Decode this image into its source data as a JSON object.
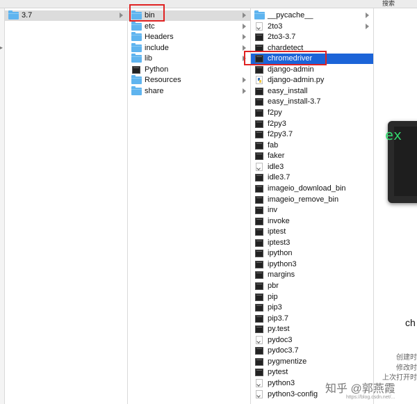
{
  "toolbar": {
    "search_label": "搜索"
  },
  "column1": {
    "items": [
      {
        "label": "3.7",
        "icon": "folder-icon",
        "has_arrow": true,
        "selected": true
      }
    ]
  },
  "column2": {
    "items": [
      {
        "label": "bin",
        "icon": "folder-icon",
        "has_arrow": true,
        "selected": true
      },
      {
        "label": "etc",
        "icon": "folder-icon",
        "has_arrow": true
      },
      {
        "label": "Headers",
        "icon": "folder-alias-icon",
        "has_arrow": true
      },
      {
        "label": "include",
        "icon": "folder-icon",
        "has_arrow": true
      },
      {
        "label": "lib",
        "icon": "folder-icon",
        "has_arrow": true
      },
      {
        "label": "Python",
        "icon": "executable-icon",
        "has_arrow": false
      },
      {
        "label": "Resources",
        "icon": "folder-icon",
        "has_arrow": true
      },
      {
        "label": "share",
        "icon": "folder-icon",
        "has_arrow": true
      }
    ]
  },
  "column3": {
    "items": [
      {
        "label": "__pycache__",
        "icon": "folder-icon",
        "has_arrow": true
      },
      {
        "label": "2to3",
        "icon": "alias-document-icon",
        "has_arrow": true
      },
      {
        "label": "2to3-3.7",
        "icon": "executable-icon",
        "has_arrow": false
      },
      {
        "label": "chardetect",
        "icon": "executable-icon",
        "has_arrow": false
      },
      {
        "label": "chromedriver",
        "icon": "executable-icon",
        "has_arrow": false,
        "selected": true
      },
      {
        "label": "django-admin",
        "icon": "executable-icon",
        "has_arrow": false
      },
      {
        "label": "django-admin.py",
        "icon": "python-file-icon",
        "has_arrow": false
      },
      {
        "label": "easy_install",
        "icon": "executable-icon",
        "has_arrow": false
      },
      {
        "label": "easy_install-3.7",
        "icon": "executable-icon",
        "has_arrow": false
      },
      {
        "label": "f2py",
        "icon": "executable-icon",
        "has_arrow": false
      },
      {
        "label": "f2py3",
        "icon": "executable-icon",
        "has_arrow": false
      },
      {
        "label": "f2py3.7",
        "icon": "executable-icon",
        "has_arrow": false
      },
      {
        "label": "fab",
        "icon": "executable-icon",
        "has_arrow": false
      },
      {
        "label": "faker",
        "icon": "executable-icon",
        "has_arrow": false
      },
      {
        "label": "idle3",
        "icon": "alias-document-icon",
        "has_arrow": false
      },
      {
        "label": "idle3.7",
        "icon": "executable-icon",
        "has_arrow": false
      },
      {
        "label": "imageio_download_bin",
        "icon": "executable-icon",
        "has_arrow": false
      },
      {
        "label": "imageio_remove_bin",
        "icon": "executable-icon",
        "has_arrow": false
      },
      {
        "label": "inv",
        "icon": "executable-icon",
        "has_arrow": false
      },
      {
        "label": "invoke",
        "icon": "executable-icon",
        "has_arrow": false
      },
      {
        "label": "iptest",
        "icon": "executable-icon",
        "has_arrow": false
      },
      {
        "label": "iptest3",
        "icon": "executable-icon",
        "has_arrow": false
      },
      {
        "label": "ipython",
        "icon": "executable-icon",
        "has_arrow": false
      },
      {
        "label": "ipython3",
        "icon": "executable-icon",
        "has_arrow": false
      },
      {
        "label": "margins",
        "icon": "executable-icon",
        "has_arrow": false
      },
      {
        "label": "pbr",
        "icon": "executable-icon",
        "has_arrow": false
      },
      {
        "label": "pip",
        "icon": "executable-icon",
        "has_arrow": false
      },
      {
        "label": "pip3",
        "icon": "executable-icon",
        "has_arrow": false
      },
      {
        "label": "pip3.7",
        "icon": "executable-icon",
        "has_arrow": false
      },
      {
        "label": "py.test",
        "icon": "executable-icon",
        "has_arrow": false
      },
      {
        "label": "pydoc3",
        "icon": "alias-document-icon",
        "has_arrow": false
      },
      {
        "label": "pydoc3.7",
        "icon": "executable-icon",
        "has_arrow": false
      },
      {
        "label": "pygmentize",
        "icon": "executable-icon",
        "has_arrow": false
      },
      {
        "label": "pytest",
        "icon": "executable-icon",
        "has_arrow": false
      },
      {
        "label": "python3",
        "icon": "alias-document-icon",
        "has_arrow": false
      },
      {
        "label": "python3-config",
        "icon": "alias-document-icon",
        "has_arrow": false
      }
    ]
  },
  "preview": {
    "terminal_text": "ex",
    "file_name": "ch",
    "created_label": "创建时",
    "modified_label": "修改时",
    "last_opened_label": "上次打开时"
  },
  "watermark": {
    "text": "知乎 @郭燕霞",
    "url": "https://blog.csdn.net/..."
  },
  "colors": {
    "selection_blue": "#1c64d8",
    "folder_blue": "#5fb4ef",
    "annotation_red": "#e02222"
  }
}
